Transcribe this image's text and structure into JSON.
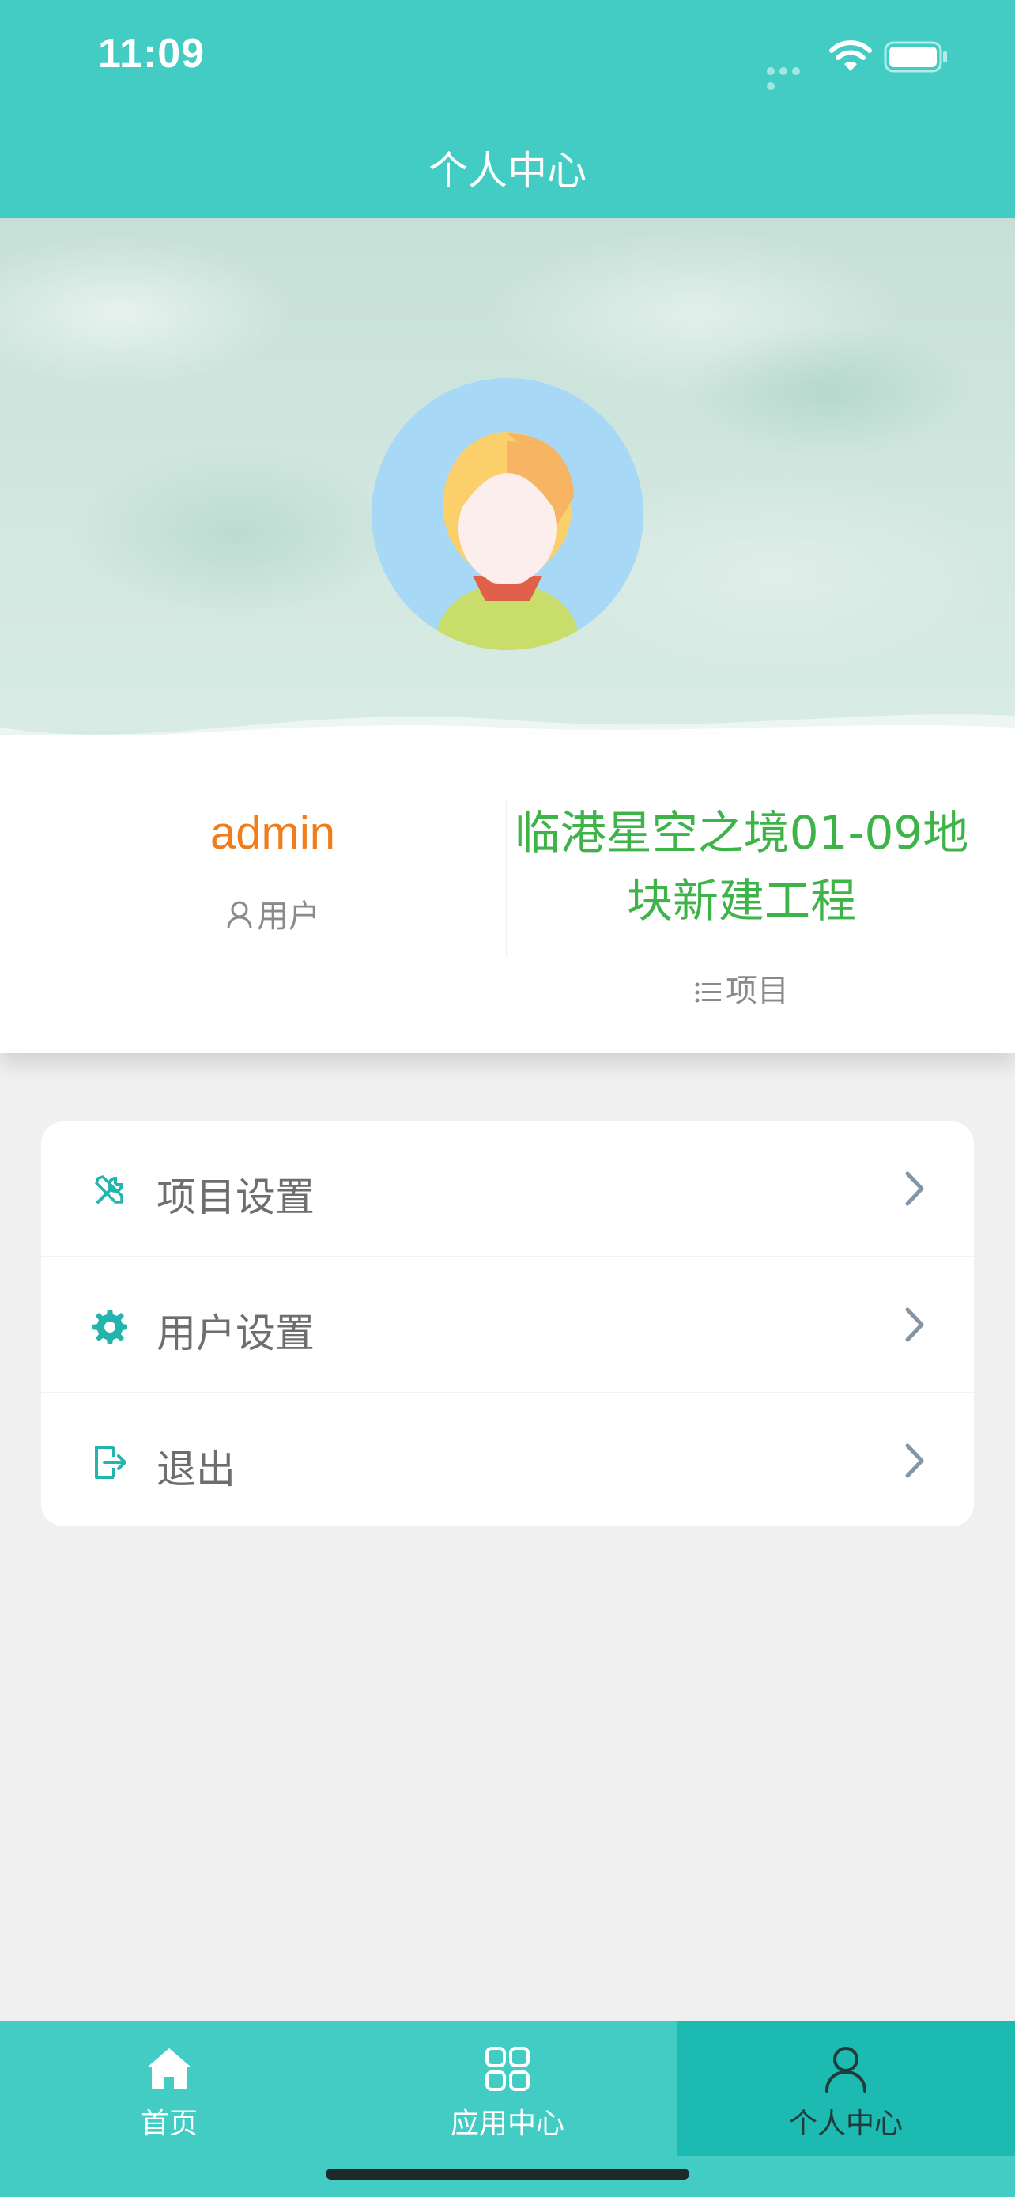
{
  "status_bar": {
    "time": "11:09"
  },
  "header": {
    "title": "个人中心"
  },
  "profile": {
    "username": "admin",
    "role_label": "用户",
    "project_name": "临港星空之境01-09地块新建工程",
    "project_label": "项目"
  },
  "menu": {
    "items": [
      {
        "label": "项目设置",
        "icon": "tools-icon"
      },
      {
        "label": "用户设置",
        "icon": "gear-icon"
      },
      {
        "label": "退出",
        "icon": "logout-icon"
      }
    ]
  },
  "tabbar": {
    "tabs": [
      {
        "label": "首页",
        "icon": "home-icon",
        "active": false
      },
      {
        "label": "应用中心",
        "icon": "grid-icon",
        "active": false
      },
      {
        "label": "个人中心",
        "icon": "user-icon",
        "active": true
      }
    ]
  },
  "colors": {
    "primary": "#43ccc4",
    "tab_active": "#1cbab0",
    "username": "#f07c1a",
    "project": "#3db348"
  }
}
